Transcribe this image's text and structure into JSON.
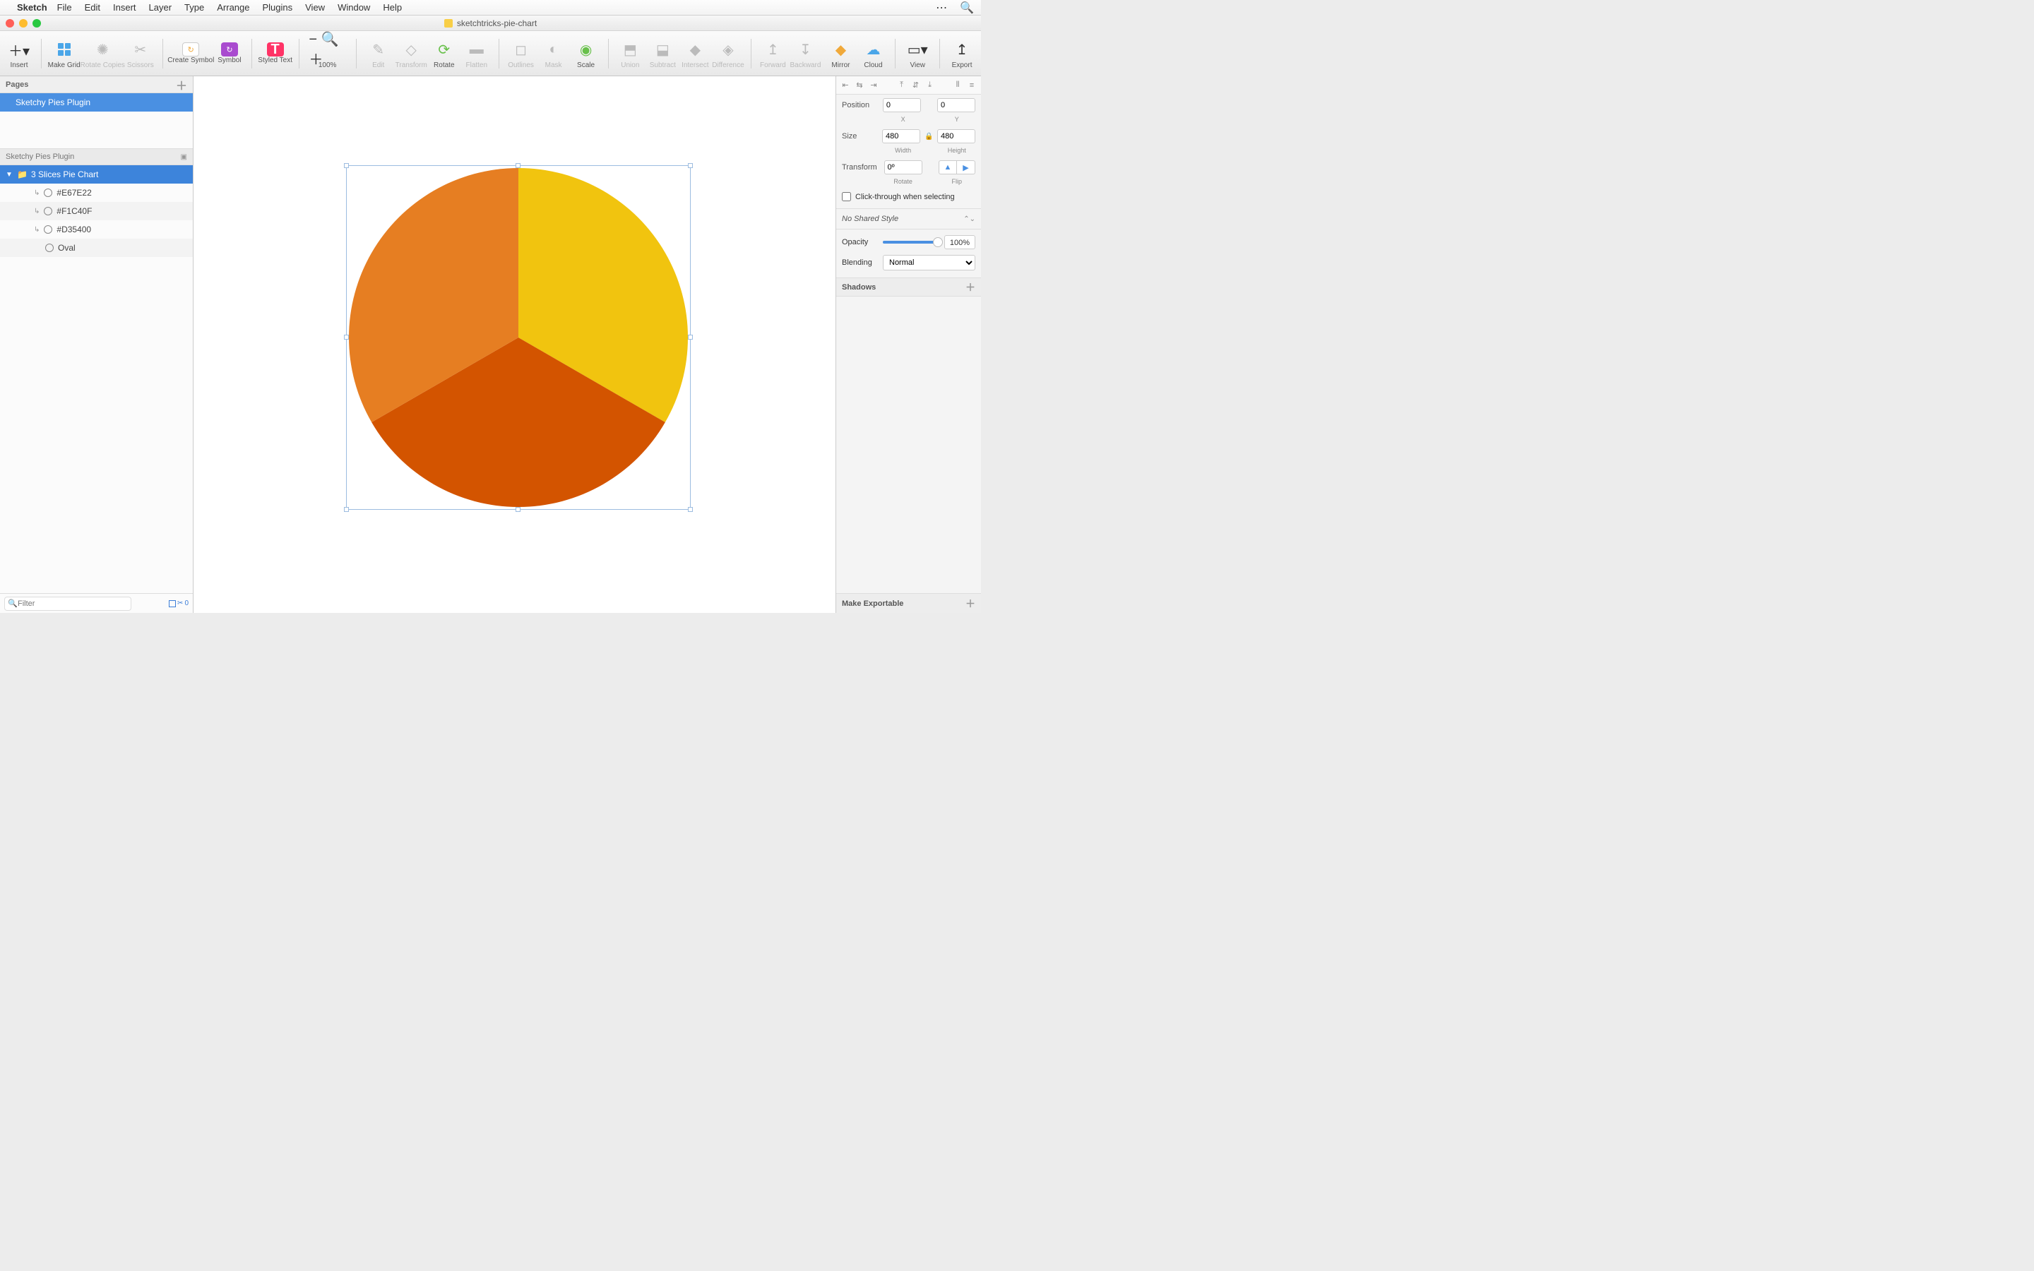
{
  "menubar": {
    "app": "Sketch",
    "items": [
      "File",
      "Edit",
      "Insert",
      "Layer",
      "Type",
      "Arrange",
      "Plugins",
      "View",
      "Window",
      "Help"
    ]
  },
  "window": {
    "title": "sketchtricks-pie-chart"
  },
  "toolbar": {
    "insert": "Insert",
    "makegrid": "Make Grid",
    "rotcopies": "Rotate Copies",
    "scissors": "Scissors",
    "createsym": "Create Symbol",
    "symbol": "Symbol",
    "styled": "Styled Text",
    "zoom": "100%",
    "edit": "Edit",
    "transform": "Transform",
    "rotate": "Rotate",
    "flatten": "Flatten",
    "outlines": "Outlines",
    "mask": "Mask",
    "scale": "Scale",
    "union": "Union",
    "subtract": "Subtract",
    "intersect": "Intersect",
    "difference": "Difference",
    "forward": "Forward",
    "backward": "Backward",
    "mirror": "Mirror",
    "cloud": "Cloud",
    "view": "View",
    "export": "Export"
  },
  "pages": {
    "label": "Pages",
    "items": [
      "Sketchy Pies Plugin"
    ]
  },
  "layers": {
    "artboard": "Sketchy Pies Plugin",
    "group": "3 Slices Pie Chart",
    "items": [
      "#E67E22",
      "#F1C40F",
      "#D35400",
      "Oval"
    ]
  },
  "filter": {
    "placeholder": "Filter",
    "count": "0"
  },
  "inspector": {
    "position_label": "Position",
    "x": "0",
    "y": "0",
    "xlab": "X",
    "ylab": "Y",
    "size_label": "Size",
    "w": "480",
    "h": "480",
    "wlab": "Width",
    "hlab": "Height",
    "transform_label": "Transform",
    "rotate": "0º",
    "rotlab": "Rotate",
    "fliplab": "Flip",
    "clickthrough": "Click-through when selecting",
    "sharedstyle": "No Shared Style",
    "opacity_label": "Opacity",
    "opacity": "100%",
    "blending_label": "Blending",
    "blending": "Normal",
    "shadows": "Shadows",
    "export": "Make Exportable"
  },
  "chart_data": {
    "type": "pie",
    "title": "3 Slices Pie Chart",
    "series": [
      {
        "name": "#F1C40F",
        "value": 33.33,
        "color": "#F1C40F"
      },
      {
        "name": "#D35400",
        "value": 33.33,
        "color": "#D35400"
      },
      {
        "name": "#E67E22",
        "value": 33.33,
        "color": "#E67E22"
      }
    ]
  }
}
